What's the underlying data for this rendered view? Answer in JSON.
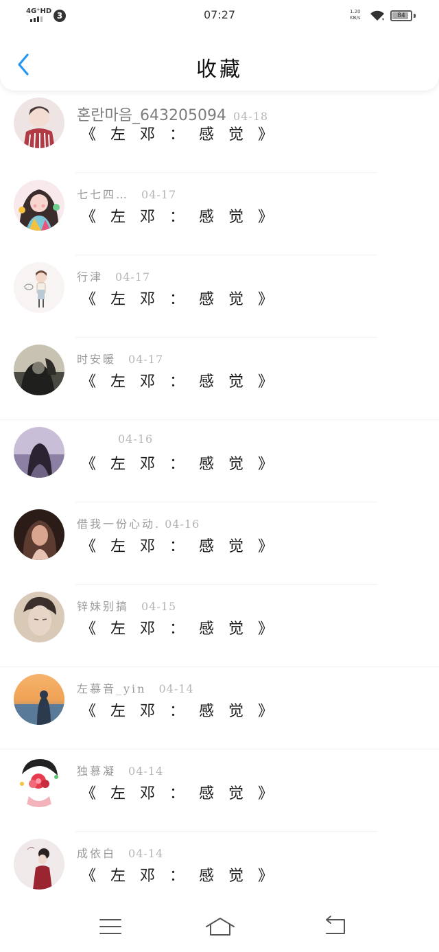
{
  "status_bar": {
    "network": "4G⁺HD",
    "notification_count": "3",
    "time": "07:27",
    "speed_value": "1.20",
    "speed_unit": "KB/s",
    "battery": "84"
  },
  "header": {
    "title": "收藏",
    "back_icon": "chevron-left-icon",
    "accent_color": "#2196f3"
  },
  "items": [
    {
      "name": "혼란마음_643205094",
      "date": "04-18",
      "title": "《 左 邓 ： 感 觉 》",
      "avatar_colors": [
        "#e9c7c7",
        "#b13a45",
        "#f5e0d6"
      ]
    },
    {
      "name": "七七四…",
      "date": "04-17",
      "title": "《 左 邓 ： 感 觉 》",
      "avatar_colors": [
        "#3b2d2c",
        "#f2b7b0",
        "#7fc6d8"
      ]
    },
    {
      "name": "行津",
      "date": "04-17",
      "title": "《 左 邓 ： 感 觉 》",
      "avatar_colors": [
        "#f6f1ef",
        "#8a7060",
        "#b9c9d6"
      ]
    },
    {
      "name": "时安暖",
      "date": "04-17",
      "title": "《 左 邓 ： 感 觉 》",
      "avatar_colors": [
        "#1f1f1d",
        "#7d7a6f",
        "#c8c2b2"
      ]
    },
    {
      "name": "",
      "date": "04-16",
      "title": "《 左 邓 ： 感 觉 》",
      "avatar_colors": [
        "#c9bed8",
        "#6f6484",
        "#2a2331"
      ]
    },
    {
      "name": "借我一份心动.",
      "date": "04-16",
      "title": "《 左 邓 ： 感 觉 》",
      "avatar_colors": [
        "#2b1c18",
        "#d9a58f",
        "#5c3b30"
      ]
    },
    {
      "name": "锌妹别搞",
      "date": "04-15",
      "title": "《 左 邓 ： 感 觉 》",
      "avatar_colors": [
        "#d9c9b7",
        "#3a2f2a",
        "#e7d6c8"
      ]
    },
    {
      "name": "左慕音_yin",
      "date": "04-14",
      "title": "《 左 邓 ： 感 觉 》",
      "avatar_colors": [
        "#f0a356",
        "#5a7a9a",
        "#2b3a4d"
      ]
    },
    {
      "name": "独慕凝",
      "date": "04-14",
      "title": "《 左 邓 ： 感 觉 》",
      "avatar_colors": [
        "#ffffff",
        "#e53b4d",
        "#222222"
      ]
    },
    {
      "name": "成依白",
      "date": "04-14",
      "title": "《 左 邓 ： 感 觉 》",
      "avatar_colors": [
        "#efe9ea",
        "#9b2431",
        "#2a2020"
      ]
    }
  ],
  "bottom_nav": {
    "menu_icon": "menu-icon",
    "home_icon": "home-icon",
    "back_icon": "back-arrow-icon"
  }
}
